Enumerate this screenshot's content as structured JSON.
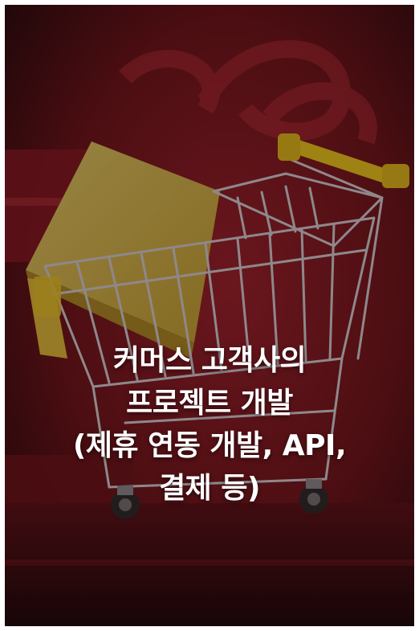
{
  "image": {
    "subject": "shopping-cart-with-card",
    "colors": {
      "background_red": "#8e1c25",
      "card_yellow": "#e2c44a",
      "handle_yellow": "#f2cf1c",
      "text": "#ffffff"
    }
  },
  "headline": {
    "lines": [
      "커머스 고객사의",
      "프로젝트 개발",
      "(제휴 연동 개발, API,",
      "결제 등)"
    ]
  }
}
